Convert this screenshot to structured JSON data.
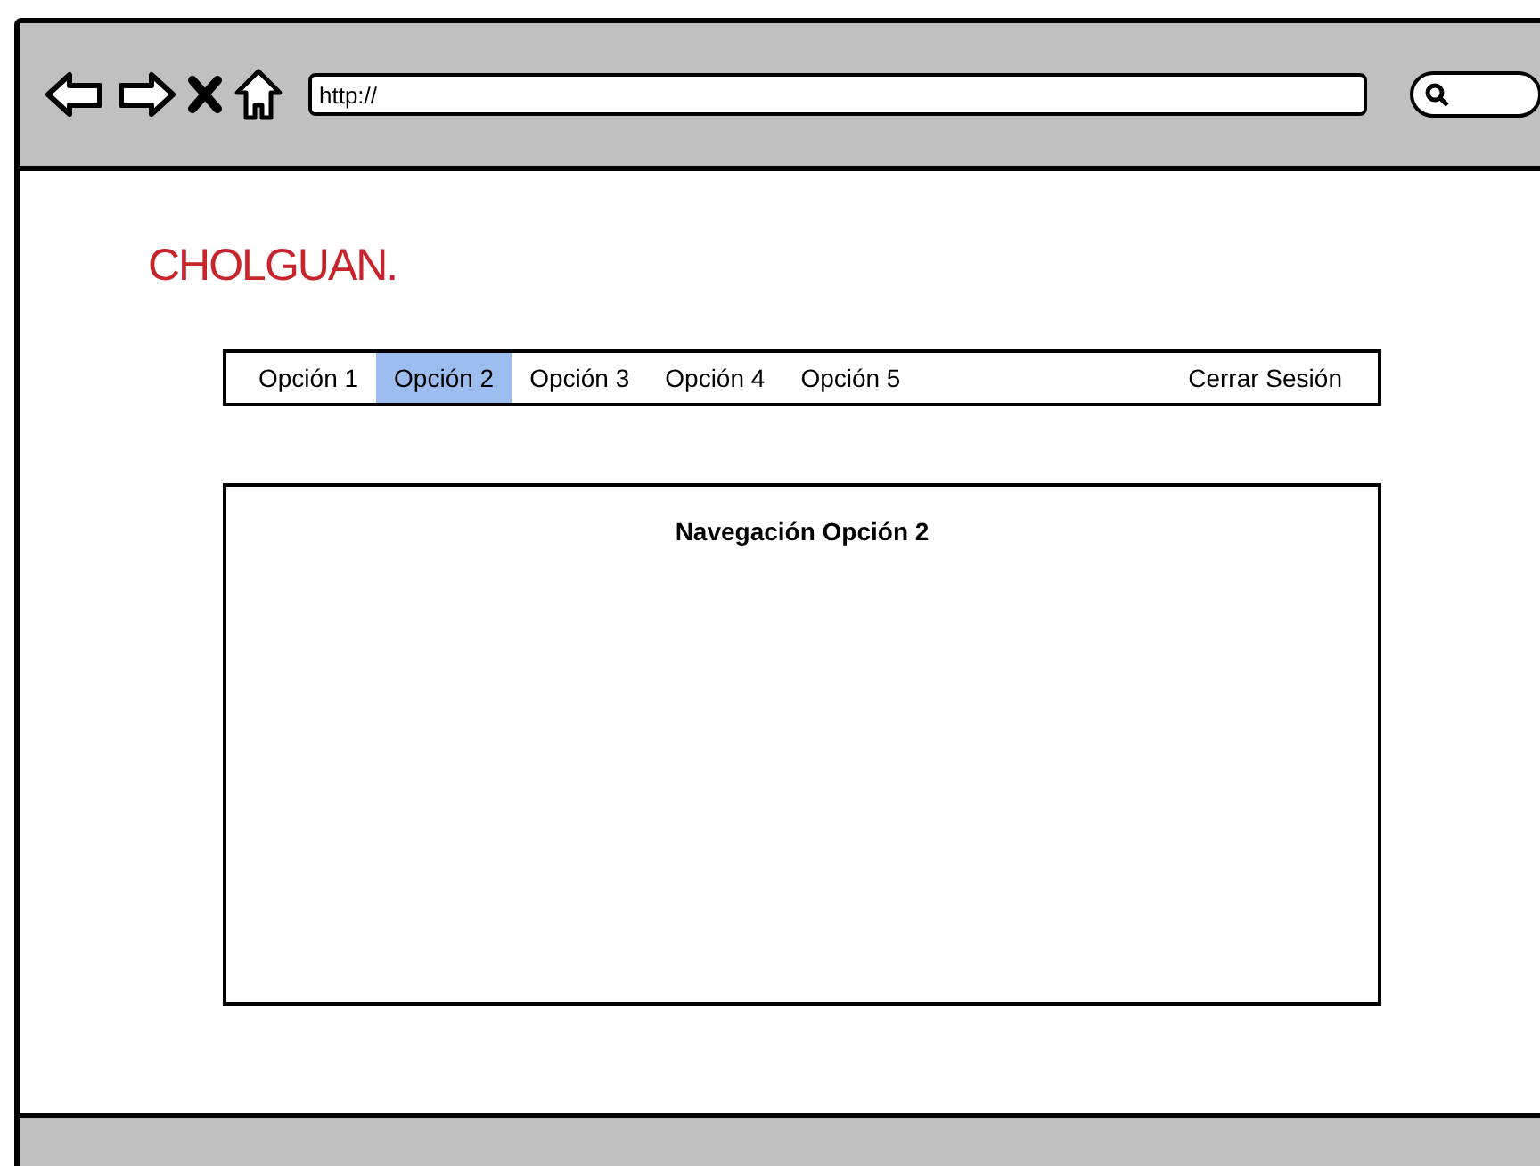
{
  "browser": {
    "url": "http://"
  },
  "logo": "CHOLGUAN.",
  "nav": {
    "items": [
      {
        "label": "Opción 1",
        "selected": false
      },
      {
        "label": "Opción 2",
        "selected": true
      },
      {
        "label": "Opción 3",
        "selected": false
      },
      {
        "label": "Opción 4",
        "selected": false
      },
      {
        "label": "Opción 5",
        "selected": false
      }
    ],
    "logout": "Cerrar Sesión"
  },
  "panel": {
    "title": "Navegación Opción 2"
  }
}
